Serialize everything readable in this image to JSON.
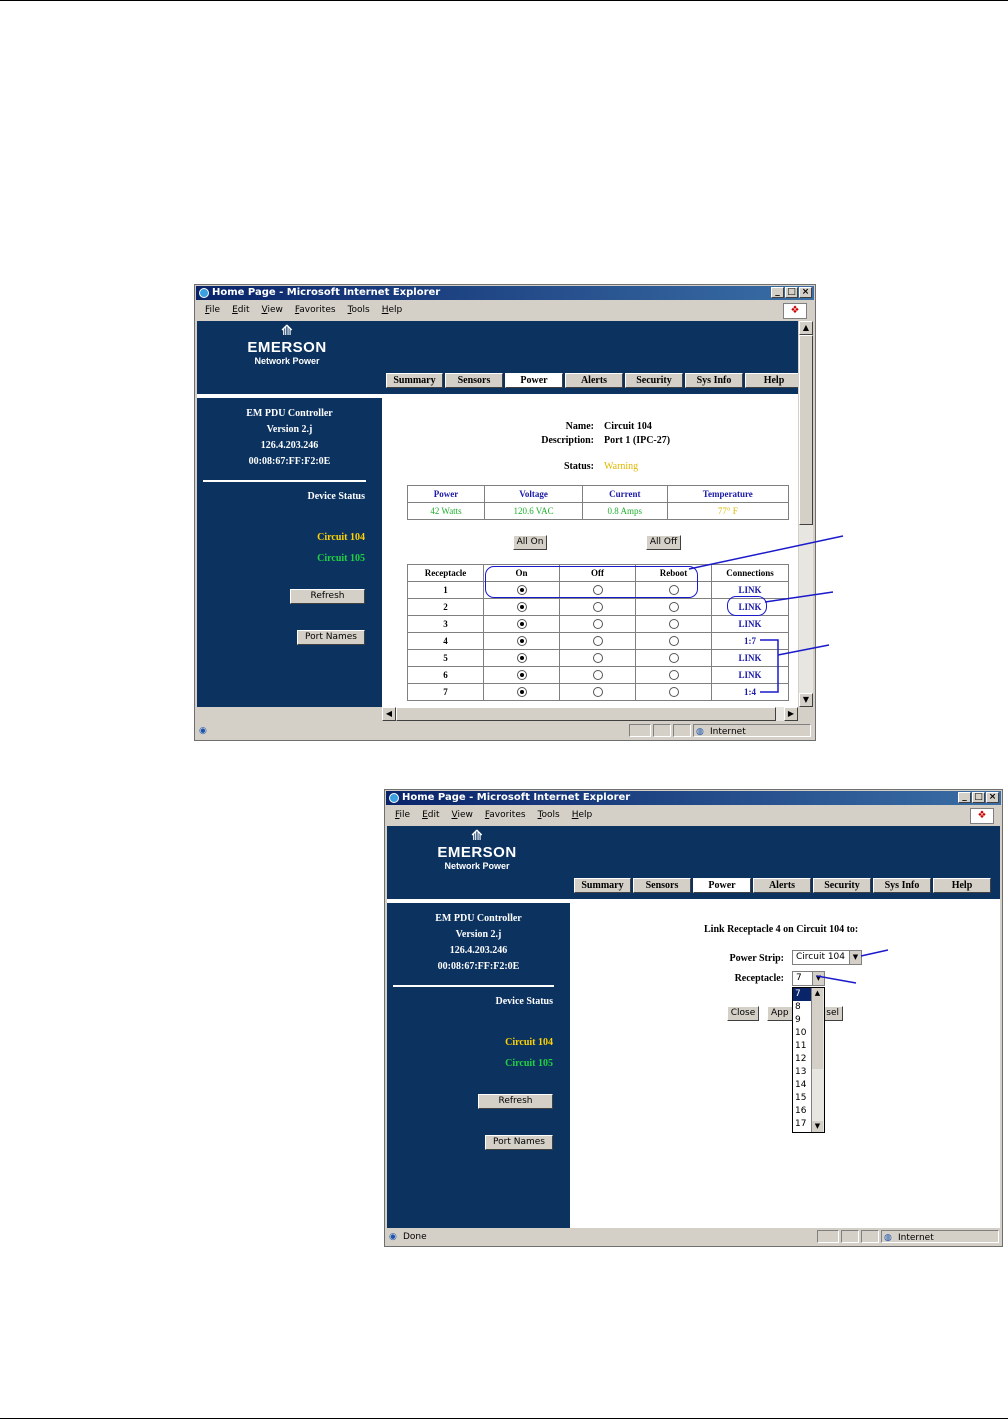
{
  "top_window": {
    "title": "Home Page - Microsoft Internet Explorer",
    "menu": [
      "File",
      "Edit",
      "View",
      "Favorites",
      "Tools",
      "Help"
    ],
    "logo": {
      "brand": "EMERSON",
      "sub": "Network Power"
    },
    "tabs": [
      "Summary",
      "Sensors",
      "Power",
      "Alerts",
      "Security",
      "Sys Info",
      "Help"
    ],
    "active_tab": "Power",
    "sidebar": {
      "controller": "EM PDU Controller",
      "version": "Version 2.j",
      "ip": "126.4.203.246",
      "mac": "00:08:67:FF:F2:0E",
      "device_status": "Device Status",
      "circuit_a": "Circuit 104",
      "circuit_b": "Circuit 105",
      "refresh": "Refresh",
      "port_names": "Port Names"
    },
    "main": {
      "name_label": "Name:",
      "name_value": "Circuit 104",
      "desc_label": "Description:",
      "desc_value": "Port 1 (IPC-27)",
      "status_label": "Status:",
      "status_value": "Warning",
      "metrics_headers": [
        "Power",
        "Voltage",
        "Current",
        "Temperature"
      ],
      "metrics_values": [
        "42 Watts",
        "120.6 VAC",
        "0.8 Amps",
        "77° F"
      ],
      "all_on": "All On",
      "all_off": "All Off",
      "table_headers": [
        "Receptacle",
        "On",
        "Off",
        "Reboot",
        "Connections"
      ],
      "rows": [
        {
          "n": "1",
          "conn": "LINK"
        },
        {
          "n": "2",
          "conn": "LINK"
        },
        {
          "n": "3",
          "conn": "LINK"
        },
        {
          "n": "4",
          "conn": "1:7"
        },
        {
          "n": "5",
          "conn": "LINK"
        },
        {
          "n": "6",
          "conn": "LINK"
        },
        {
          "n": "7",
          "conn": "1:4"
        }
      ]
    },
    "status": {
      "zone": "Internet",
      "text": ""
    }
  },
  "bottom_window": {
    "title": "Home Page - Microsoft Internet Explorer",
    "menu": [
      "File",
      "Edit",
      "View",
      "Favorites",
      "Tools",
      "Help"
    ],
    "logo": {
      "brand": "EMERSON",
      "sub": "Network Power"
    },
    "tabs": [
      "Summary",
      "Sensors",
      "Power",
      "Alerts",
      "Security",
      "Sys Info",
      "Help"
    ],
    "active_tab": "Power",
    "sidebar": {
      "controller": "EM PDU Controller",
      "version": "Version 2.j",
      "ip": "126.4.203.246",
      "mac": "00:08:67:FF:F2:0E",
      "device_status": "Device Status",
      "circuit_a": "Circuit 104",
      "circuit_b": "Circuit 105",
      "refresh": "Refresh",
      "port_names": "Port Names"
    },
    "main": {
      "heading": "Link Receptacle 4 on Circuit 104 to:",
      "strip_label": "Power Strip:",
      "strip_value": "Circuit 104",
      "receptacle_label": "Receptacle:",
      "receptacle_value": "7",
      "close": "Close",
      "apply_visible": "App",
      "cancel_visible": "sel",
      "dropdown_options": [
        "7",
        "8",
        "9",
        "10",
        "11",
        "12",
        "13",
        "14",
        "15",
        "16",
        "17"
      ],
      "dropdown_selected": "7"
    },
    "status": {
      "text": "Done",
      "zone": "Internet"
    }
  }
}
